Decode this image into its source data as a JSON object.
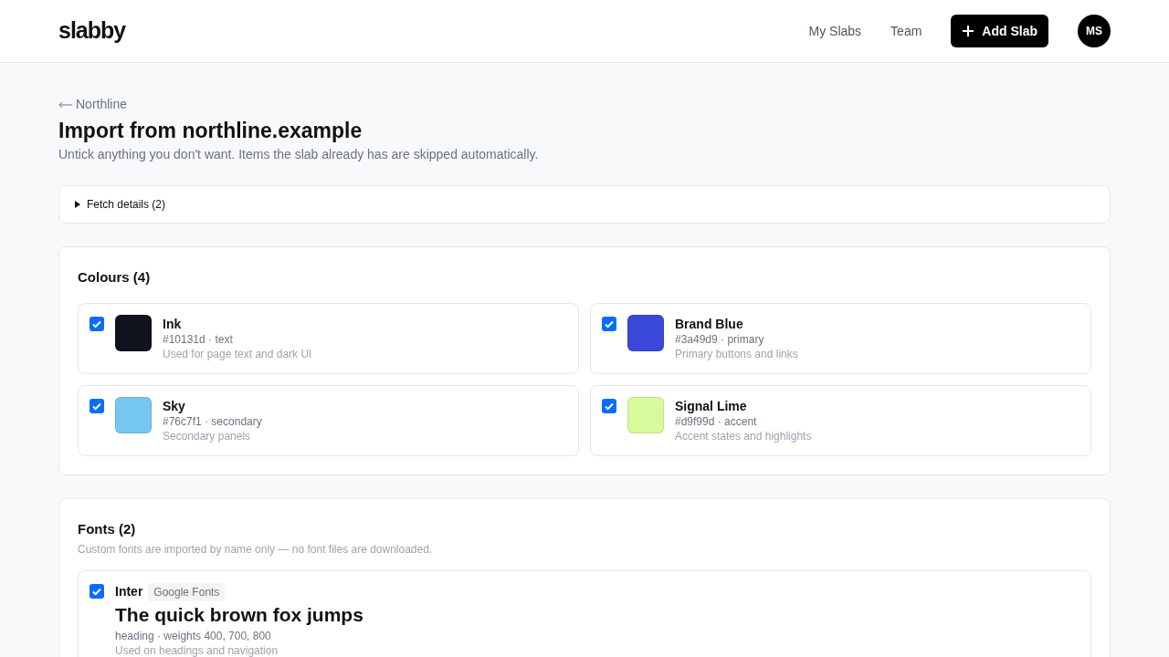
{
  "header": {
    "logo": "slabby",
    "nav": [
      "My Slabs",
      "Team"
    ],
    "add_button": "Add Slab",
    "avatar": "MS"
  },
  "back_link": "Northline",
  "title": "Import from northline.example",
  "subtitle": "Untick anything you don't want. Items the slab already has are skipped automatically.",
  "fetch_details": {
    "label": "Fetch details (2)",
    "expanded": false
  },
  "colours": {
    "heading": "Colours (4)",
    "items": [
      {
        "name": "Ink",
        "meta": "#10131d · text",
        "description": "Used for page text and dark UI",
        "color": "#10131d",
        "checked": true
      },
      {
        "name": "Brand Blue",
        "meta": "#3a49d9 · primary",
        "description": "Primary buttons and links",
        "color": "#3a49d9",
        "checked": true
      },
      {
        "name": "Sky",
        "meta": "#76c7f1 · secondary",
        "description": "Secondary panels",
        "color": "#76c7f1",
        "checked": true
      },
      {
        "name": "Signal Lime",
        "meta": "#d9f99d · accent",
        "description": "Accent states and highlights",
        "color": "#d9f99d",
        "checked": true
      }
    ]
  },
  "fonts": {
    "heading": "Fonts (2)",
    "note": "Custom fonts are imported by name only — no font files are downloaded.",
    "items": [
      {
        "name": "Inter",
        "source": "Google Fonts",
        "sample": "The quick brown fox jumps",
        "meta": "heading · weights 400, 700, 800",
        "description": "Used on headings and navigation",
        "checked": true
      }
    ]
  }
}
